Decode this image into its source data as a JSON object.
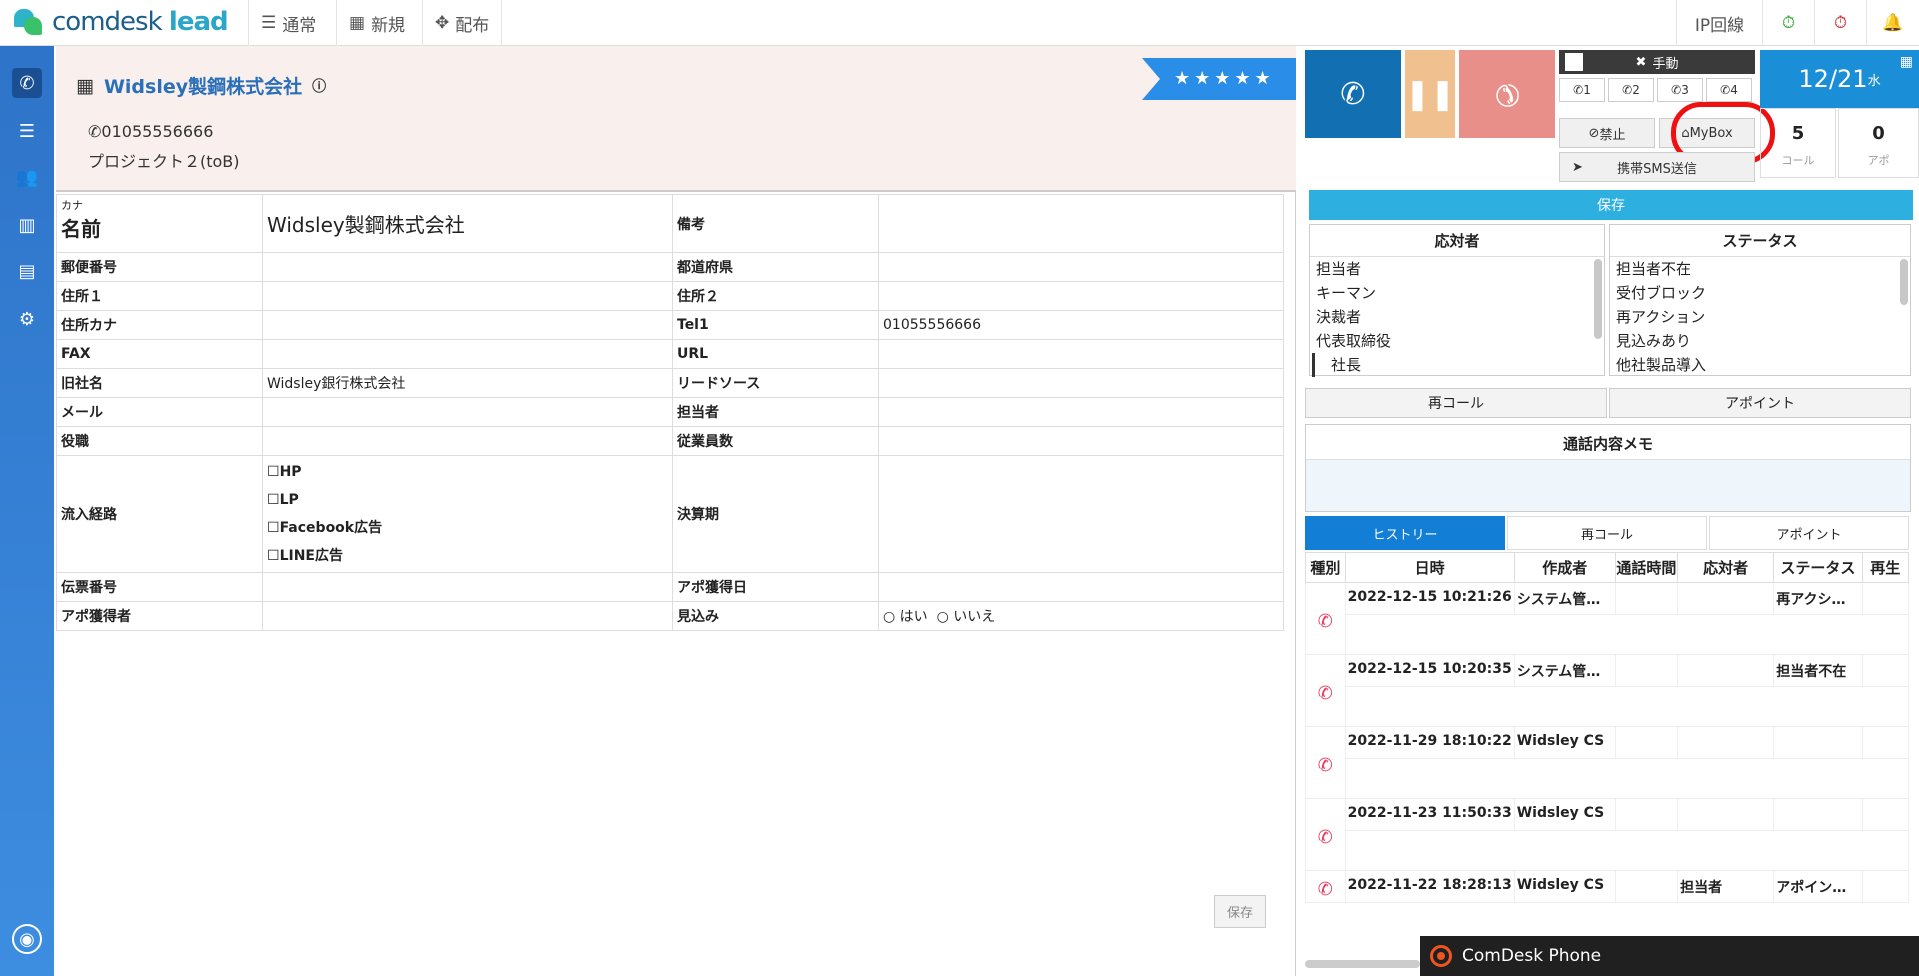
{
  "brand": {
    "name_a": "comdesk",
    "name_b": "lead"
  },
  "nav": {
    "normal": "通常",
    "new": "新規",
    "distribute": "配布",
    "ip_line": "IP回線"
  },
  "header": {
    "company": "Widsley製鋼株式会社",
    "phone": "01055556666",
    "project": "プロジェクト２(toB)",
    "rating": "★★★★★"
  },
  "form": {
    "kana_label": "カナ",
    "name_label": "名前",
    "name_value": "Widsley製鋼株式会社",
    "remarks_label": "備考",
    "rows": [
      {
        "l1": "郵便番号",
        "v1": "",
        "l2": "都道府県",
        "v2": ""
      },
      {
        "l1": "住所１",
        "v1": "",
        "l2": "住所２",
        "v2": ""
      },
      {
        "l1": "住所カナ",
        "v1": "",
        "l2": "Tel1",
        "v2": "01055556666"
      },
      {
        "l1": "FAX",
        "v1": "",
        "l2": "URL",
        "v2": ""
      },
      {
        "l1": "旧社名",
        "v1": "Widsley銀行株式会社",
        "l2": "リードソース",
        "v2": ""
      },
      {
        "l1": "メール",
        "v1": "",
        "l2": "担当者",
        "v2": ""
      },
      {
        "l1": "役職",
        "v1": "",
        "l2": "従業員数",
        "v2": ""
      }
    ],
    "inflow_label": "流入経路",
    "inflow_options": [
      "HP",
      "LP",
      "Facebook広告",
      "LINE広告"
    ],
    "fiscal_label": "決算期",
    "slip_label": "伝票番号",
    "apo_date_label": "アポ獲得日",
    "apo_person_label": "アポ獲得者",
    "prospect_label": "見込み",
    "yes": "はい",
    "no": "いいえ",
    "save": "保存"
  },
  "phone": {
    "manual": "手動",
    "lines": [
      "1",
      "2",
      "3",
      "4"
    ],
    "ban": "禁止",
    "mybox": "MyBox",
    "sms": "携帯SMS送信",
    "date": "12/21",
    "weekday": "水",
    "calls": "5",
    "calls_label": "コール",
    "apo": "0",
    "apo_label": "アポ",
    "save": "保存"
  },
  "responder": {
    "title": "応対者",
    "items": [
      "担当者",
      "キーマン",
      "決裁者",
      "代表取締役",
      "社長"
    ]
  },
  "status": {
    "title": "ステータス",
    "items": [
      "担当者不在",
      "受付ブロック",
      "再アクション",
      "見込みあり",
      "他社製品導入"
    ]
  },
  "actions": {
    "recall": "再コール",
    "appoint": "アポイント"
  },
  "memo": {
    "title": "通話内容メモ"
  },
  "tabs": [
    "ヒストリー",
    "再コール",
    "アポイント"
  ],
  "history": {
    "columns": [
      "種別",
      "日時",
      "作成者",
      "通話時間",
      "応対者",
      "ステータス",
      "再生"
    ],
    "rows": [
      {
        "date": "2022-12-15 10:21:26",
        "creator": "システム管…",
        "duration": "",
        "responder": "",
        "status": "再アクシ…"
      },
      {
        "date": "2022-12-15 10:20:35",
        "creator": "システム管…",
        "duration": "",
        "responder": "",
        "status": "担当者不在"
      },
      {
        "date": "2022-11-29 18:10:22",
        "creator": "Widsley CS",
        "duration": "",
        "responder": "",
        "status": ""
      },
      {
        "date": "2022-11-23 11:50:33",
        "creator": "Widsley CS",
        "duration": "",
        "responder": "",
        "status": ""
      },
      {
        "date": "2022-11-22 18:28:13",
        "creator": "Widsley CS",
        "duration": "",
        "responder": "担当者",
        "status": "アポイン…"
      }
    ]
  },
  "phonebar": {
    "label": "ComDesk Phone"
  }
}
